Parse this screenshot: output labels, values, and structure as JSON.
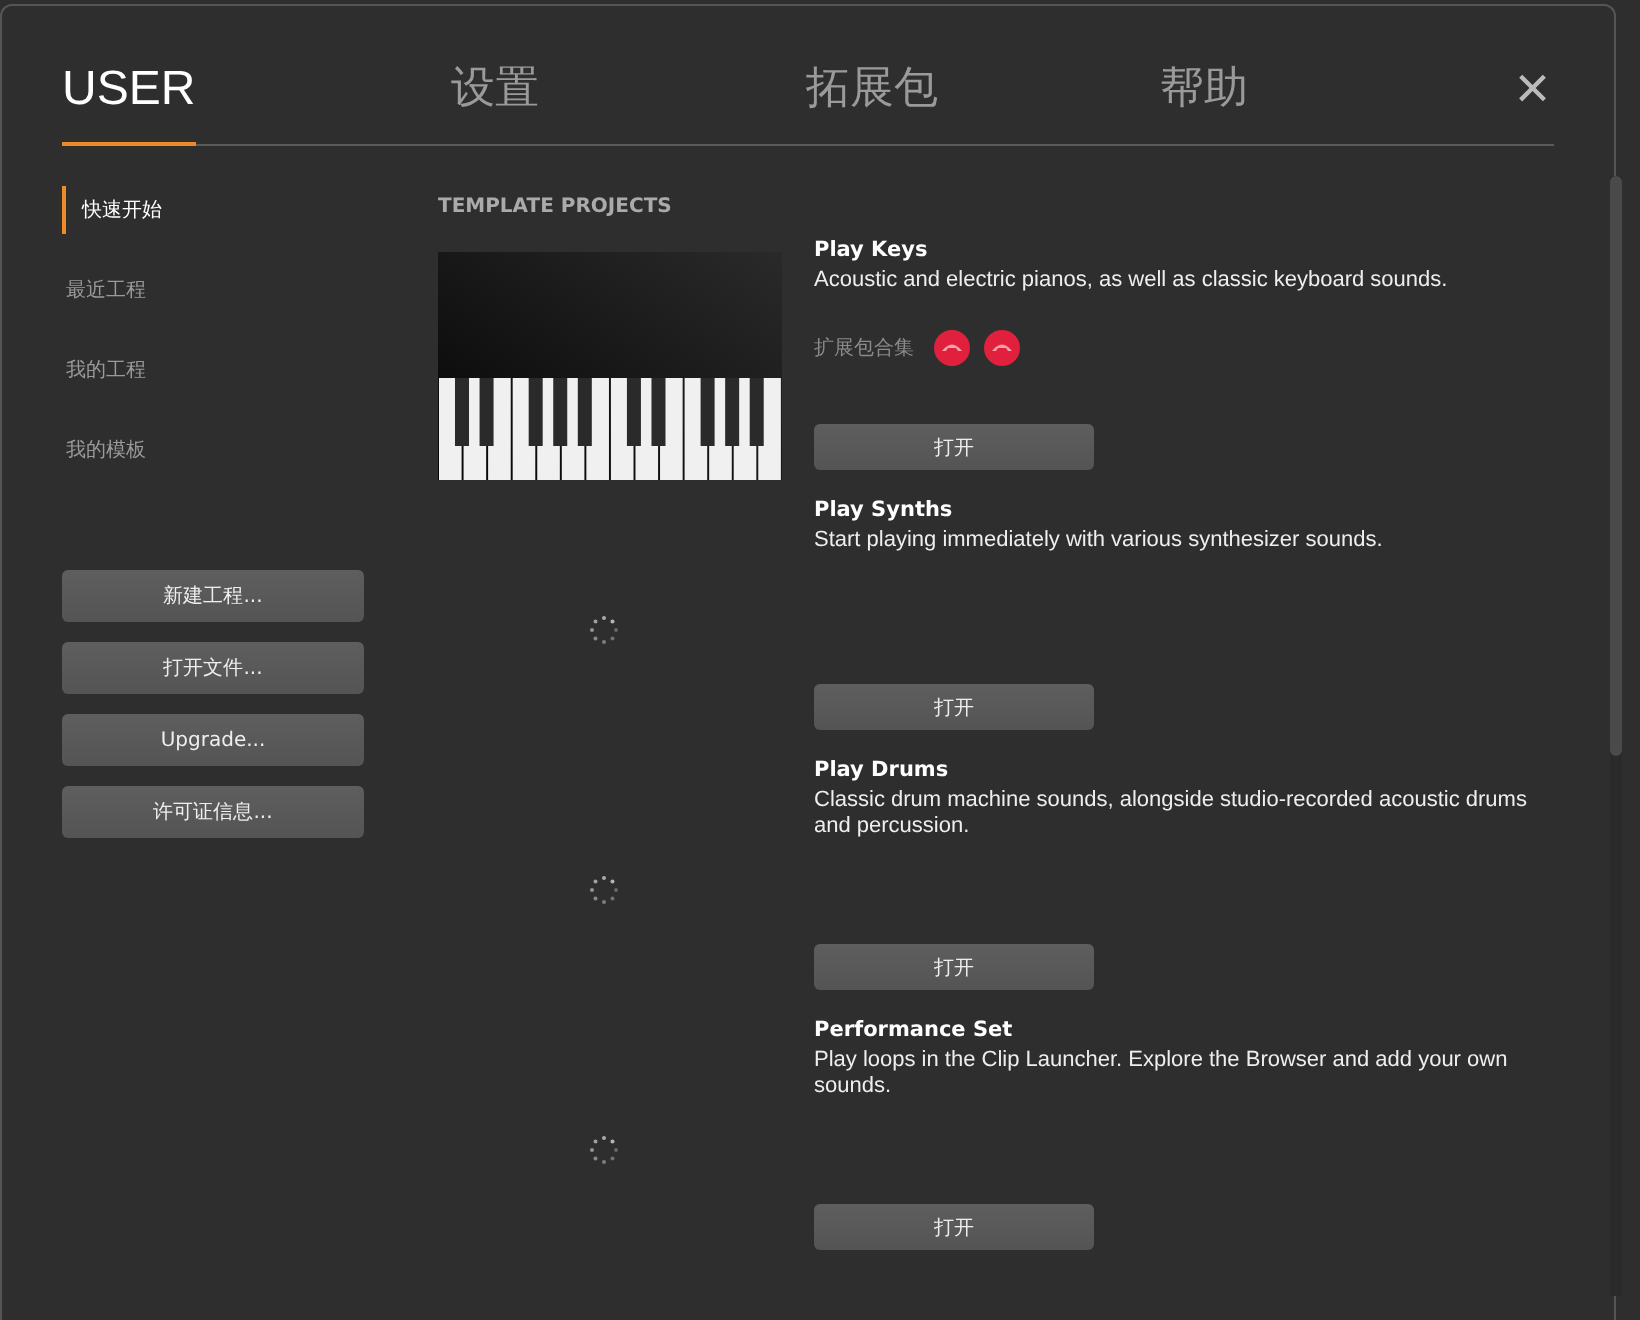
{
  "tabs": [
    {
      "label": "USER",
      "selected": true
    },
    {
      "label": "设置",
      "selected": false
    },
    {
      "label": "拓展包",
      "selected": false
    },
    {
      "label": "帮助",
      "selected": false
    }
  ],
  "close": "×",
  "sidebar": {
    "items": [
      {
        "label": "快速开始",
        "selected": true
      },
      {
        "label": "最近工程",
        "selected": false
      },
      {
        "label": "我的工程",
        "selected": false
      },
      {
        "label": "我的模板",
        "selected": false
      }
    ],
    "buttons": [
      "新建工程...",
      "打开文件...",
      "Upgrade...",
      "许可证信息..."
    ]
  },
  "section_title": "TEMPLATE PROJECTS",
  "projects": [
    {
      "title": "Play Keys",
      "description": "Acoustic and electric pianos, as well as classic keyboard sounds.",
      "kind": "piano",
      "packs_label": "扩展包合集",
      "button": "打开"
    },
    {
      "title": "Play Synths",
      "description": "Start playing immediately with various synthesizer sounds.",
      "kind": "loading",
      "button": "打开"
    },
    {
      "title": "Play Drums",
      "description": "Classic drum machine sounds, alongside studio-recorded acoustic drums and percussion.",
      "kind": "loading",
      "button": "打开"
    },
    {
      "title": "Performance Set",
      "description": "Play loops in the Clip Launcher. Explore the Browser and add your own sounds.",
      "kind": "loading",
      "button": "打开"
    }
  ]
}
